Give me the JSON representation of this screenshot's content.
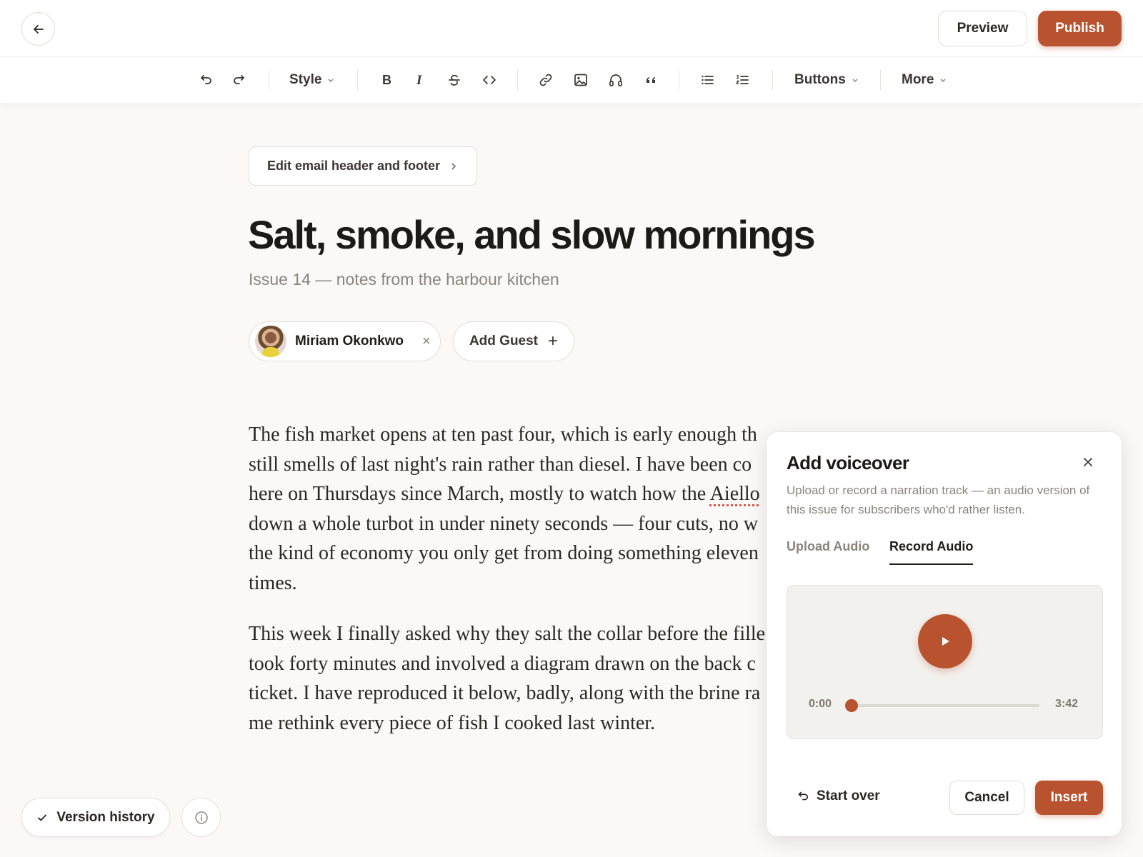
{
  "header": {
    "back_icon": "arrow-left-icon",
    "preview_label": "Preview",
    "publish_label": "Publish",
    "accent_color": "#b9532f"
  },
  "toolbar": {
    "style_label": "Style",
    "buttons_label": "Buttons",
    "more_label": "More",
    "icons": [
      "undo-icon",
      "redo-icon",
      "bold-icon",
      "italic-icon",
      "strikethrough-icon",
      "code-icon",
      "link-icon",
      "image-icon",
      "headphones-icon",
      "quote-icon",
      "bullet-list-icon",
      "numbered-list-icon"
    ]
  },
  "editor": {
    "edit_header_label": "Edit email header and footer",
    "title": "Salt, smoke, and slow mornings",
    "subtitle": "Issue 14 — notes from the harbour kitchen",
    "author_name": "Miriam Okonkwo",
    "add_guest_label": "Add Guest",
    "paragraph1": {
      "line1": "The fish market opens at ten past four, which is early enough th",
      "line2": "still smells of last night's rain rather than diesel. I have been co",
      "line3_a": "here on Thursdays since March, mostly to watch how the ",
      "line3_b": "Aiello",
      "line4": "down a whole turbot in under ninety seconds — four cuts, no w",
      "line5": "the kind of economy you only get from doing something eleven",
      "line6": "times."
    },
    "paragraph2": {
      "line1": "This week I finally asked why they salt the collar before the fille",
      "line2": "took forty minutes and involved a diagram drawn on the back c",
      "line3": "ticket. I have reproduced it below, badly, along with the brine ra",
      "line4": "me rethink every piece of fish I cooked last winter."
    }
  },
  "footer": {
    "version_history_label": "Version history"
  },
  "voiceover": {
    "title": "Add voiceover",
    "description": "Upload or record a narration track — an audio version of this issue for subscribers who'd rather listen.",
    "tabs": [
      {
        "label": "Upload Audio",
        "active": false
      },
      {
        "label": "Record Audio",
        "active": true
      }
    ],
    "player": {
      "current_time": "0:00",
      "duration": "3:42",
      "progress": 0
    },
    "start_over_label": "Start over",
    "cancel_label": "Cancel",
    "insert_label": "Insert"
  }
}
